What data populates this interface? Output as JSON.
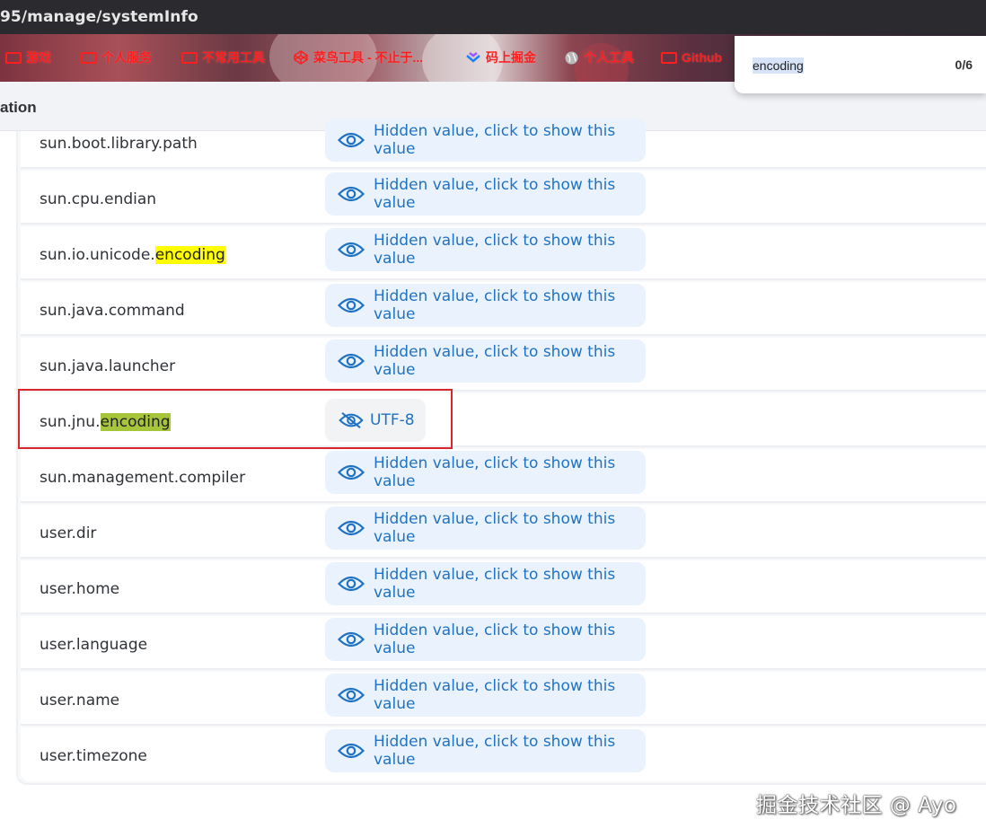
{
  "browser": {
    "url": "95/manage/systemInfo"
  },
  "bookmarks": [
    {
      "label": "游戏",
      "icon": "folder-icon"
    },
    {
      "label": "个人服务",
      "icon": "folder-icon"
    },
    {
      "label": "不常用工具",
      "icon": "folder-icon"
    },
    {
      "label": "菜鸟工具 - 不止于...",
      "icon": "codepen-icon"
    },
    {
      "label": "码上掘金",
      "icon": "juejin-icon"
    },
    {
      "label": "个人工具",
      "icon": "globe-icon"
    },
    {
      "label": "Github",
      "icon": "folder-icon"
    }
  ],
  "header": {
    "title": "ation"
  },
  "find": {
    "query": "encoding",
    "count": "0/6"
  },
  "hidden_label": "Hidden value, click to show this value",
  "rows": [
    {
      "key": "sun.boot.library.path"
    },
    {
      "key": "sun.cpu.endian"
    },
    {
      "key_prefix": "sun.io.unicode.",
      "key_match": "encoding"
    },
    {
      "key": "sun.java.command"
    },
    {
      "key": "sun.java.launcher"
    },
    {
      "key_prefix": "sun.jnu.",
      "key_match": "encoding",
      "value": "UTF-8"
    },
    {
      "key": "sun.management.compiler"
    },
    {
      "key": "user.dir"
    },
    {
      "key": "user.home"
    },
    {
      "key": "user.language"
    },
    {
      "key": "user.name"
    },
    {
      "key": "user.timezone"
    }
  ],
  "watermark": "掘金技术社区 @ Ayo",
  "colors": {
    "link": "#1f72c4",
    "hidden_bg": "#eaf3fd",
    "match_current": "#a6c53a",
    "match_other": "#ffff00",
    "annotation_box": "#d9262c"
  }
}
